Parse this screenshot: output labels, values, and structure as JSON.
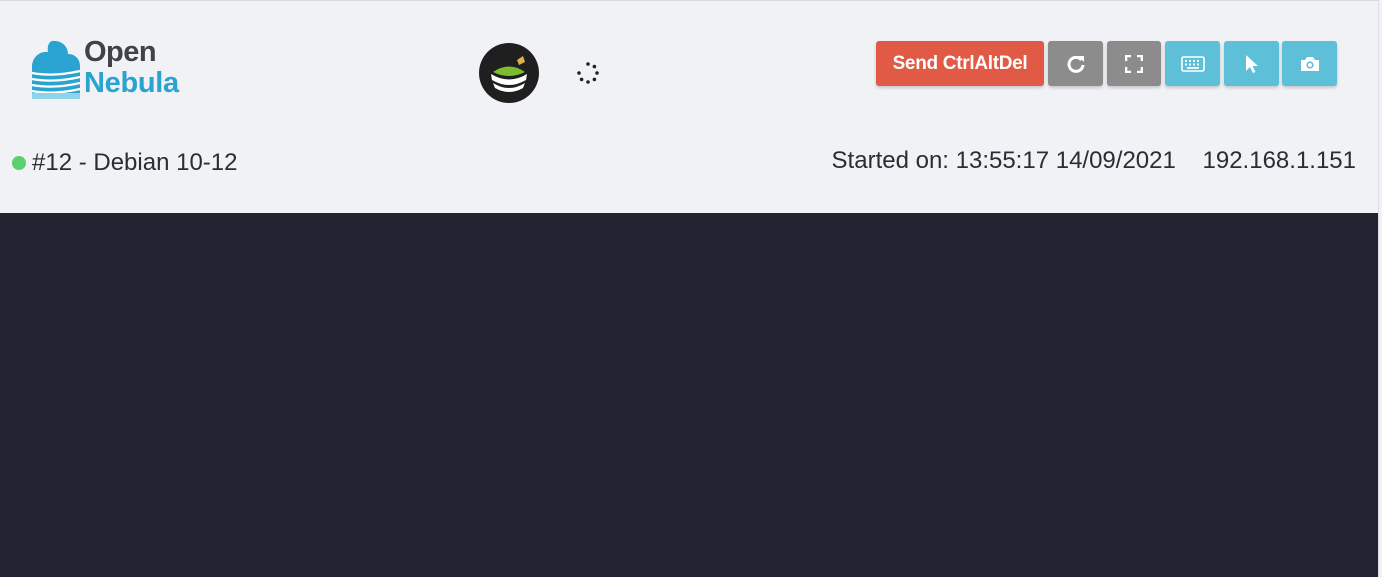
{
  "logo": {
    "line1": "Open",
    "line2": "Nebula"
  },
  "toolbar": {
    "send_cad_label": "Send CtrlAltDel",
    "buttons": [
      "reload-icon",
      "fullscreen-icon",
      "keyboard-icon",
      "pointer-icon",
      "camera-icon"
    ]
  },
  "vm": {
    "status": "running",
    "name": "#12 - Debian 10-12",
    "started_on": "Started on: 13:55:17 14/09/2021",
    "ip": "192.168.1.151"
  },
  "colors": {
    "header_bg": "#f1f2f6",
    "console_bg": "#222531",
    "danger": "#e05a45",
    "neutral": "#8c8c8c",
    "info": "#5ebfd8",
    "status_ok": "#5bd06e",
    "brand_blue": "#2ba3d0"
  }
}
